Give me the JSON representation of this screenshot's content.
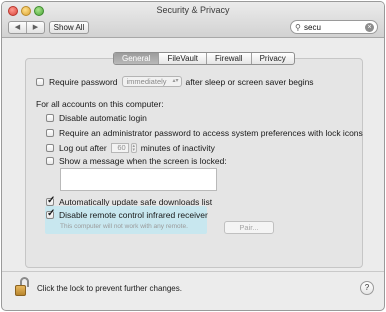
{
  "window": {
    "title": "Security & Privacy"
  },
  "toolbar": {
    "back_glyph": "◀",
    "forward_glyph": "▶",
    "show_all_label": "Show All"
  },
  "search": {
    "value": "secu",
    "clear_glyph": "×"
  },
  "tabs": [
    {
      "label": "General",
      "active": true
    },
    {
      "label": "FileVault",
      "active": false
    },
    {
      "label": "Firewall",
      "active": false
    },
    {
      "label": "Privacy",
      "active": false
    }
  ],
  "general": {
    "require_password": {
      "label": "Require password",
      "checked": false,
      "interval_value": "immediately",
      "suffix": "after sleep or screen saver begins"
    },
    "all_accounts_heading": "For all accounts on this computer:",
    "disable_auto_login": {
      "label": "Disable automatic login",
      "checked": false
    },
    "require_admin_password": {
      "label": "Require an administrator password to access system preferences with lock icons",
      "checked": false
    },
    "log_out": {
      "label_before": "Log out after",
      "minutes_value": "60",
      "label_after": "minutes of inactivity",
      "checked": false
    },
    "show_message": {
      "label": "Show a message when the screen is locked:",
      "checked": false,
      "message_value": ""
    },
    "auto_update": {
      "label": "Automatically update safe downloads list",
      "checked": true
    },
    "disable_ir": {
      "label": "Disable remote control infrared receiver",
      "checked": true,
      "note": "This computer will not work with any remote."
    },
    "pair_button_label": "Pair..."
  },
  "footer": {
    "lock_text": "Click the lock to prevent further changes.",
    "help_label": "?"
  },
  "colors": {
    "highlight": "#c8e7ef",
    "active_tab": "#9c9c9c",
    "lock_gold": "#d9a64c"
  },
  "icons": [
    "close-window-icon",
    "minimize-window-icon",
    "zoom-window-icon",
    "search-icon",
    "lock-icon",
    "help-icon"
  ]
}
